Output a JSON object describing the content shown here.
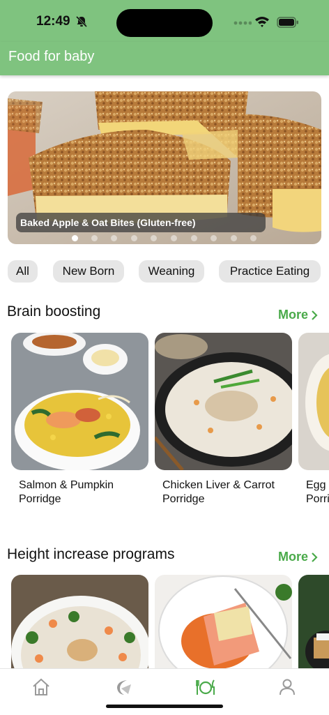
{
  "status_bar": {
    "time": "12:49"
  },
  "app_bar": {
    "title": "Food for baby"
  },
  "hero": {
    "caption": "Baked Apple & Oat Bites (Gluten-free)",
    "page_count": 10,
    "active_page": 0
  },
  "categories": [
    "All",
    "New Born",
    "Weaning",
    "Practice Eating"
  ],
  "sections": [
    {
      "title": "Brain boosting",
      "more_label": "More",
      "items": [
        {
          "name": "Salmon & Pumpkin Porridge"
        },
        {
          "name": "Chicken Liver & Carrot Porridge"
        },
        {
          "name": "Egg Porri"
        }
      ]
    },
    {
      "title": "Height increase programs",
      "more_label": "More"
    }
  ],
  "tab_bar": {
    "tabs": [
      {
        "icon": "home-icon"
      },
      {
        "icon": "moon-icon"
      },
      {
        "icon": "food-icon",
        "active": true
      },
      {
        "icon": "user-icon"
      }
    ],
    "active_color": "#4aaa4a",
    "inactive_color": "#9a9a9a"
  },
  "colors": {
    "brand": "#7fc37f",
    "accent": "#4aaa4a",
    "chip_bg": "#e6e6e6"
  }
}
